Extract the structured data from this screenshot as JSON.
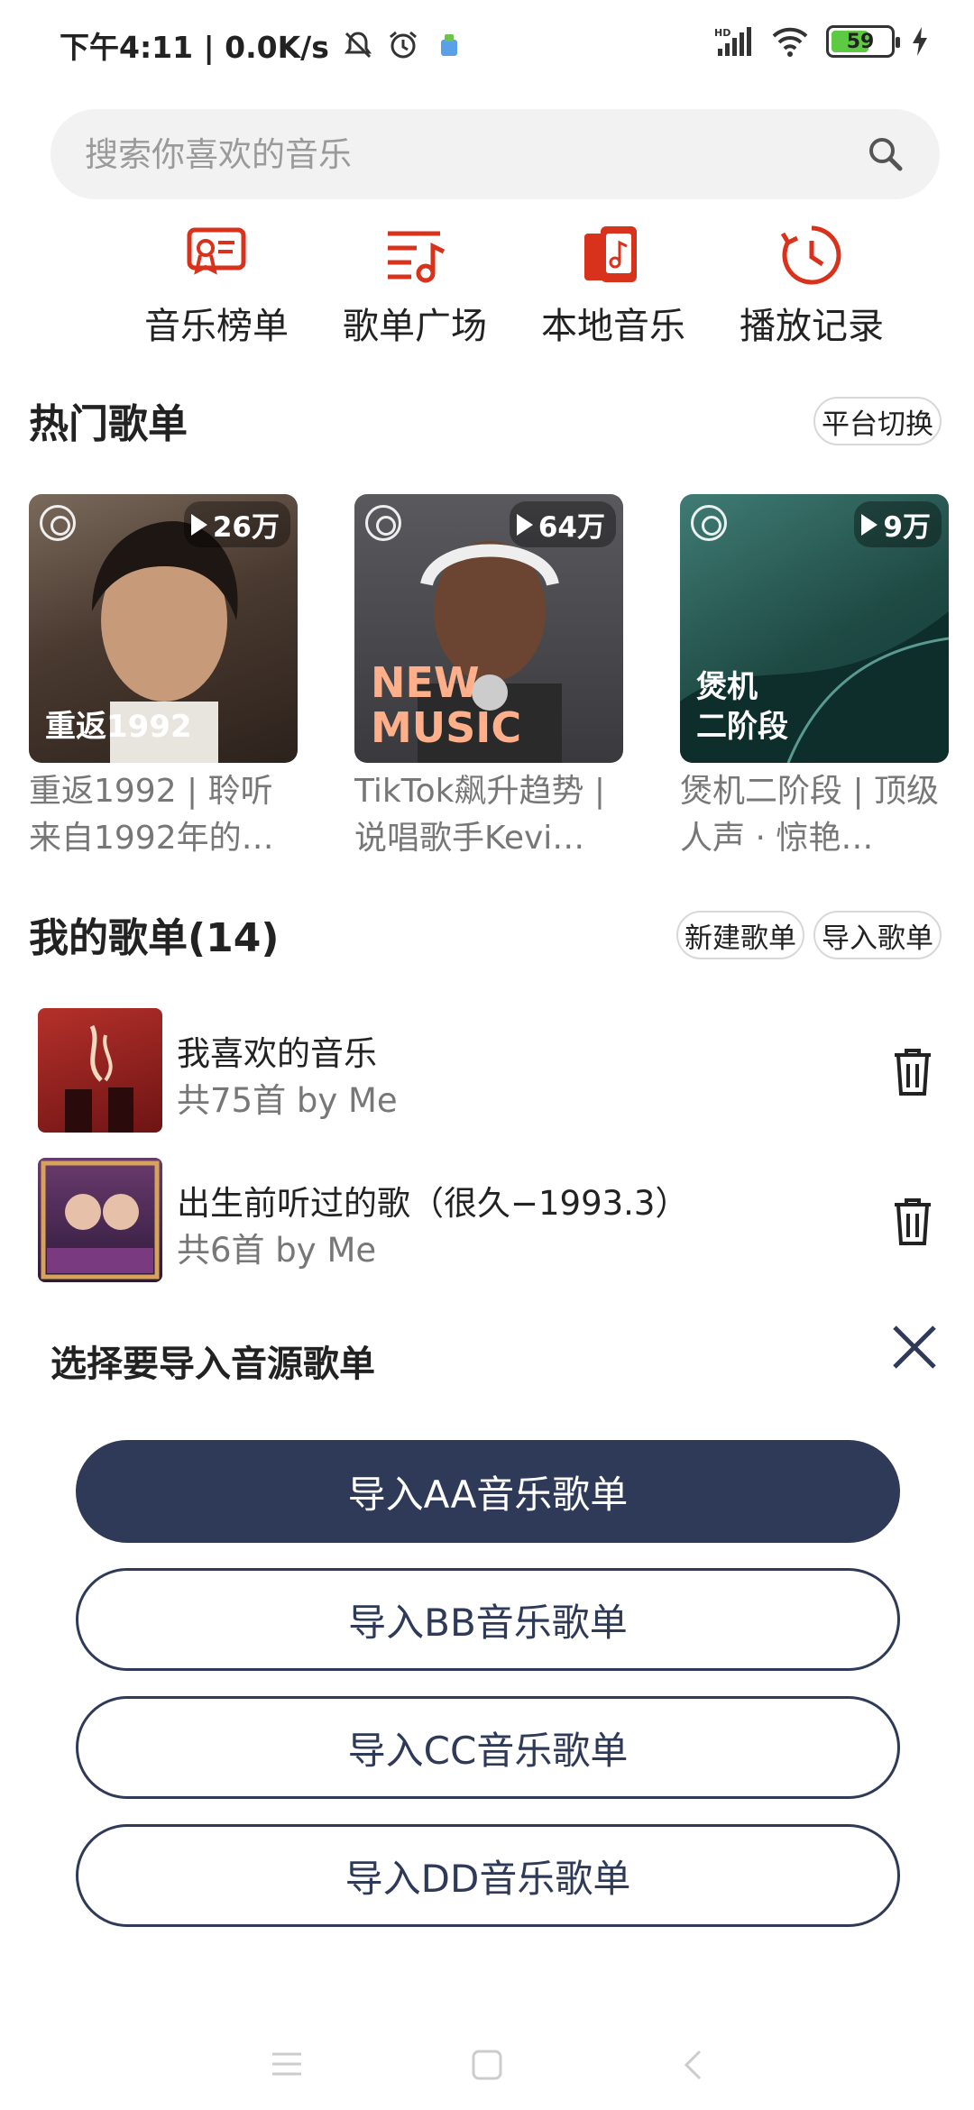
{
  "status_bar": {
    "time_and_speed": "下午4:11 | 0.0K/s",
    "battery": "59"
  },
  "search": {
    "placeholder": "搜索你喜欢的音乐"
  },
  "quick_nav": [
    {
      "label": "音乐榜单",
      "icon": "chart-certificate-icon"
    },
    {
      "label": "歌单广场",
      "icon": "playlist-music-icon"
    },
    {
      "label": "本地音乐",
      "icon": "local-music-phone-icon"
    },
    {
      "label": "播放记录",
      "icon": "history-clock-icon"
    }
  ],
  "hot": {
    "title": "热门歌单",
    "switch_label": "平台切换",
    "cards": [
      {
        "plays": "26万",
        "cover_text": "重返1992",
        "desc": "重返1992 | 聆听来自1992年的…"
      },
      {
        "plays": "64万",
        "cover_text": "NEW MUSIC",
        "desc": "TikTok飙升趋势 | 说唱歌手Kevi…"
      },
      {
        "plays": "9万",
        "cover_text": "煲机\n二阶段",
        "desc": "煲机二阶段 | 顶级人声 · 惊艳…"
      }
    ]
  },
  "mine": {
    "title": "我的歌单(14)",
    "new_label": "新建歌单",
    "import_label": "导入歌单",
    "items": [
      {
        "title": "我喜欢的音乐",
        "sub": "共75首 by Me"
      },
      {
        "title": "出生前听过的歌（很久−1993.3）",
        "sub": "共6首 by Me"
      }
    ]
  },
  "sheet": {
    "title": "选择要导入音源歌单",
    "buttons": [
      "导入AA音乐歌单",
      "导入BB音乐歌单",
      "导入CC音乐歌单",
      "导入DD音乐歌单"
    ]
  },
  "colors": {
    "accent_red": "#d8321c",
    "button_navy": "#2e3a57"
  }
}
